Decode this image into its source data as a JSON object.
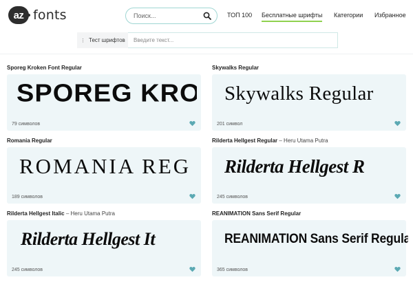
{
  "header": {
    "logo_badge": "az",
    "logo_text": "fonts",
    "search_placeholder": "Поиск...",
    "nav": [
      "ТОП 100",
      "Бесплатные шрифты",
      "Категории",
      "Избранное"
    ]
  },
  "tester": {
    "label": "Тест шрифтов",
    "placeholder": "Введите текст..."
  },
  "fonts": [
    {
      "title": "Sporeg Kroken Font Regular",
      "author": "",
      "preview": "SPOREG KRO",
      "count": "79 символов"
    },
    {
      "title": "Skywalks Regular",
      "author": "",
      "preview": "Skywalks Regular",
      "count": "201 символ"
    },
    {
      "title": "Romania Regular",
      "author": "",
      "preview": "ROMANIA REG",
      "count": "189 символов"
    },
    {
      "title": "Rilderta Hellgest Regular",
      "author": "– Heru Utama Putra",
      "preview": "Rilderta Hellgest R",
      "count": "245 символов"
    },
    {
      "title": "Rilderta Hellgest Italic",
      "author": "– Heru Utama Putra",
      "preview": "Rilderta Hellgest It",
      "count": "245 символов"
    },
    {
      "title": "REANIMATION Sans Serif Regular",
      "author": "",
      "preview": "REANIMATION Sans Serif Regula",
      "count": "365 символов"
    }
  ],
  "colors": {
    "accent_teal": "#5ba9b3",
    "active_underline": "#8fd14f",
    "card_bg": "#eef6f8"
  },
  "icons": {
    "search": "search-icon",
    "favorite": "heart-icon",
    "tester": "grip-icon"
  }
}
